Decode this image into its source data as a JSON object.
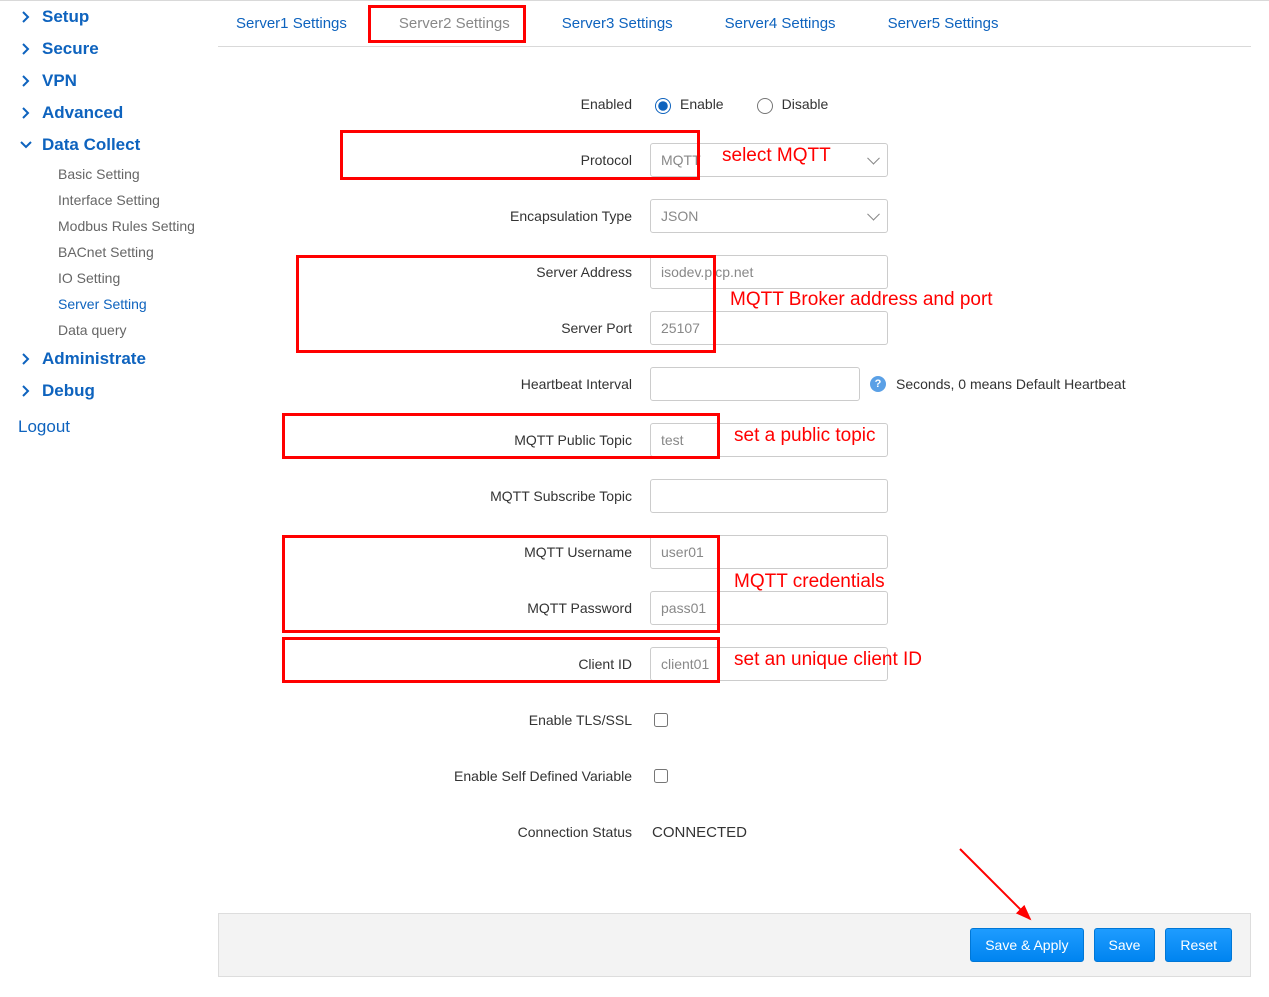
{
  "sidebar": {
    "items": [
      {
        "label": "Setup",
        "expanded": false
      },
      {
        "label": "Secure",
        "expanded": false
      },
      {
        "label": "VPN",
        "expanded": false
      },
      {
        "label": "Advanced",
        "expanded": false
      },
      {
        "label": "Data Collect",
        "expanded": true,
        "children": [
          {
            "label": "Basic Setting",
            "active": false
          },
          {
            "label": "Interface Setting",
            "active": false
          },
          {
            "label": "Modbus Rules Setting",
            "active": false
          },
          {
            "label": "BACnet Setting",
            "active": false
          },
          {
            "label": "IO Setting",
            "active": false
          },
          {
            "label": "Server Setting",
            "active": true
          },
          {
            "label": "Data query",
            "active": false
          }
        ]
      },
      {
        "label": "Administrate",
        "expanded": false
      },
      {
        "label": "Debug",
        "expanded": false
      }
    ],
    "logout": "Logout"
  },
  "tabs": [
    {
      "label": "Server1 Settings"
    },
    {
      "label": "Server2 Settings"
    },
    {
      "label": "Server3 Settings"
    },
    {
      "label": "Server4 Settings"
    },
    {
      "label": "Server5 Settings"
    }
  ],
  "form": {
    "enabled_label": "Enabled",
    "enable_opt": "Enable",
    "disable_opt": "Disable",
    "protocol_label": "Protocol",
    "protocol_value": "MQTT",
    "encap_label": "Encapsulation Type",
    "encap_value": "JSON",
    "server_addr_label": "Server Address",
    "server_addr_value": "isodev.picp.net",
    "server_port_label": "Server Port",
    "server_port_value": "25107",
    "heartbeat_label": "Heartbeat Interval",
    "heartbeat_value": "",
    "heartbeat_hint": "Seconds, 0 means Default Heartbeat",
    "pub_topic_label": "MQTT Public Topic",
    "pub_topic_value": "test",
    "sub_topic_label": "MQTT Subscribe Topic",
    "sub_topic_value": "",
    "mqtt_user_label": "MQTT Username",
    "mqtt_user_value": "user01",
    "mqtt_pass_label": "MQTT Password",
    "mqtt_pass_value": "pass01",
    "client_id_label": "Client ID",
    "client_id_value": "client01",
    "tls_label": "Enable TLS/SSL",
    "selfvar_label": "Enable Self Defined Variable",
    "conn_status_label": "Connection Status",
    "conn_status_value": "CONNECTED"
  },
  "annotations": {
    "a1": "select MQTT",
    "a2": "MQTT Broker address and port",
    "a3": "set a public topic",
    "a4": "MQTT credentials",
    "a5": "set an unique client ID"
  },
  "footer": {
    "save_apply": "Save & Apply",
    "save": "Save",
    "reset": "Reset"
  }
}
